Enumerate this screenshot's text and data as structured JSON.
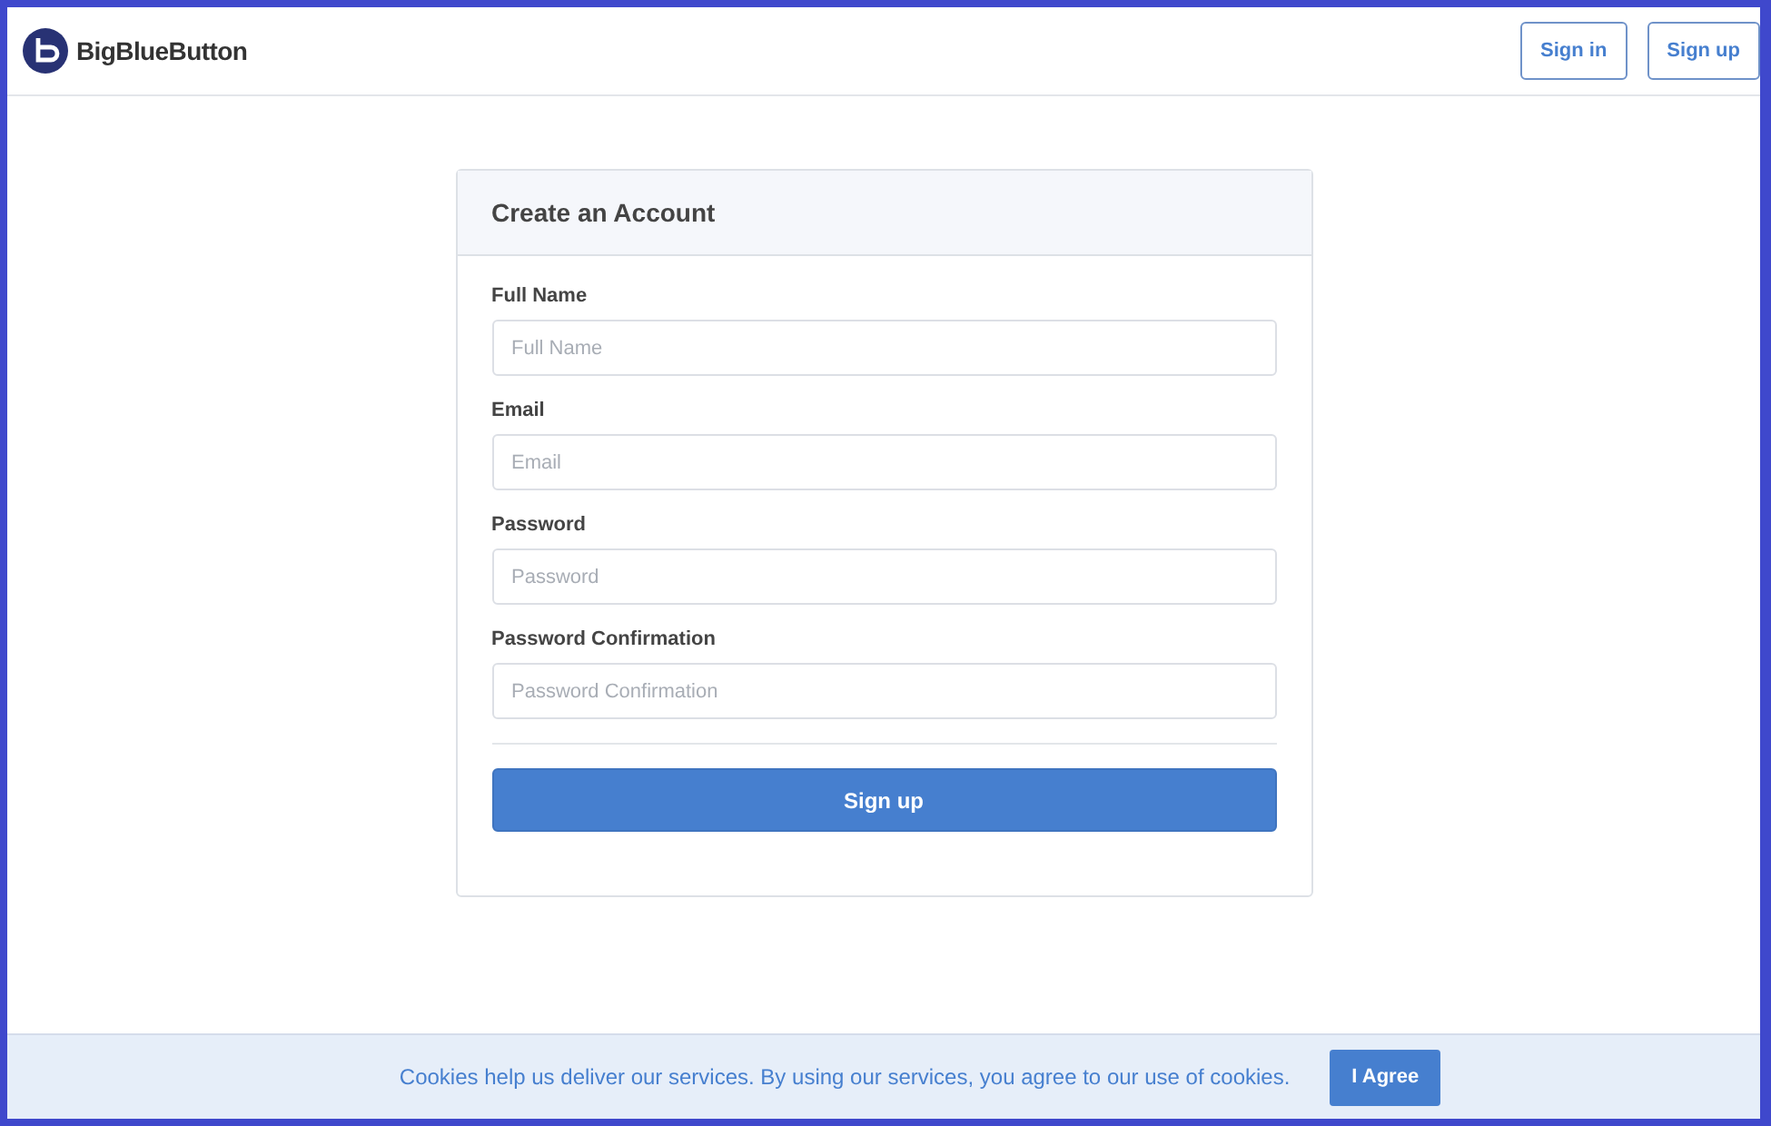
{
  "header": {
    "brand": "BigBlueButton",
    "buttons": [
      "Sign in",
      "Sign up"
    ]
  },
  "card": {
    "title": "Create an Account",
    "fields": [
      {
        "label": "Full Name",
        "placeholder": "Full Name"
      },
      {
        "label": "Email",
        "placeholder": "Email"
      },
      {
        "label": "Password",
        "placeholder": "Password"
      },
      {
        "label": "Password Confirmation",
        "placeholder": "Password Confirmation"
      }
    ],
    "submit": "Sign up"
  },
  "cookie_bar": {
    "message": "Cookies help us deliver our services. By using our services, you agree to our use of cookies.",
    "button": "I Agree"
  }
}
